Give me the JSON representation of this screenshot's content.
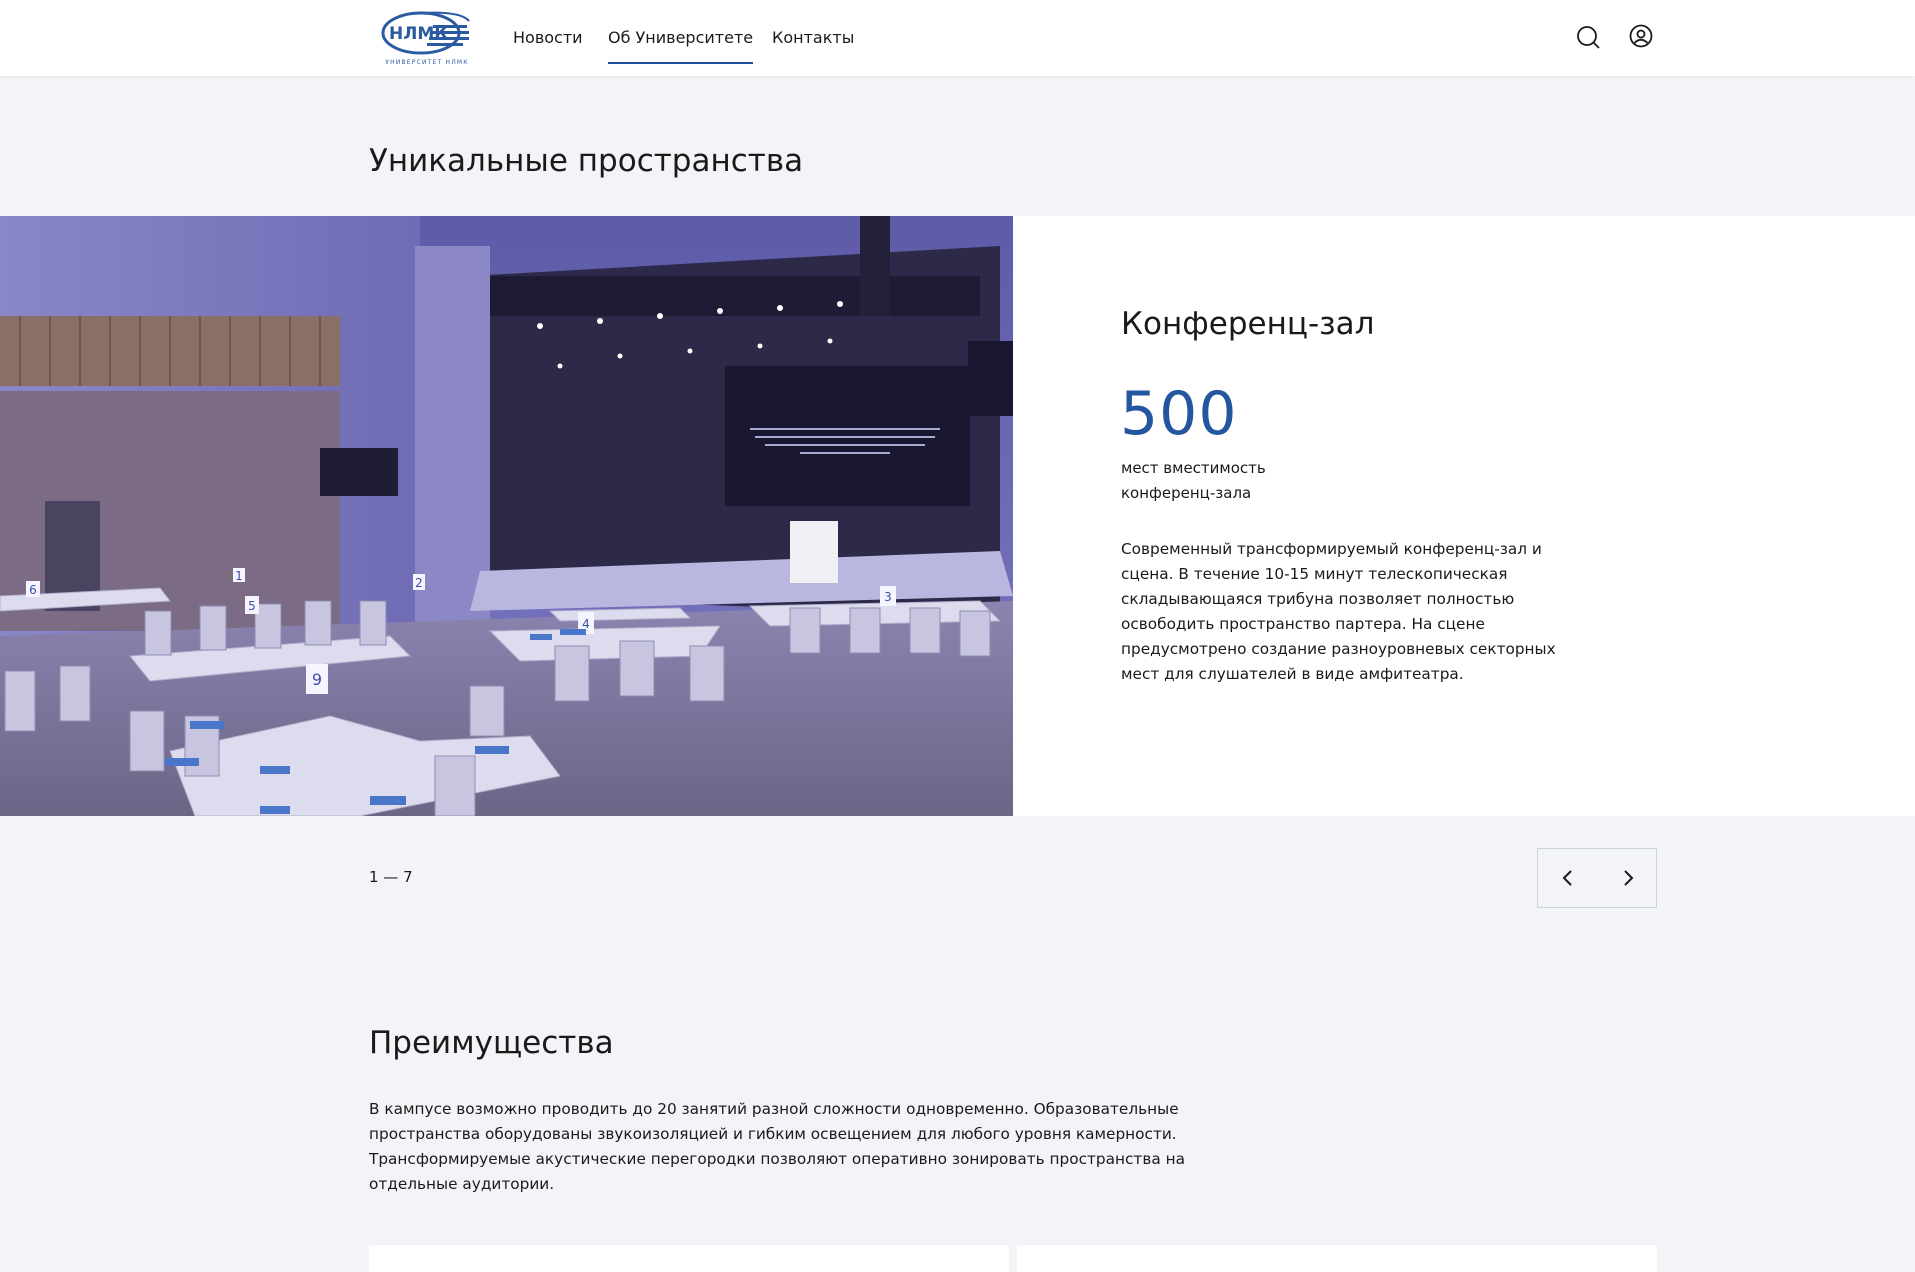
{
  "header": {
    "logo_text": "НЛМК",
    "logo_subtitle": "УНИВЕРСИТЕТ НЛМК",
    "nav": [
      {
        "label": "Новости",
        "active": false
      },
      {
        "label": "Об Университете",
        "active": true
      },
      {
        "label": "Контакты",
        "active": false
      }
    ],
    "icons": [
      "search-icon",
      "user-icon"
    ]
  },
  "spaces": {
    "title": "Уникальные пространства",
    "slide": {
      "title": "Конференц-зал",
      "number": "500",
      "caption_line1": "мест вместимость",
      "caption_line2": "конференц-зала",
      "description": "Современный трансформируемый конференц-зал и сцена. В течение 10-15 минут телескопическая складывающаяся трибуна позволяет полностью освободить пространство партера. На сцене предусмотрено создание разноуровневых секторных мест для слушателей в виде амфитеатра.",
      "image": {
        "alt": "Conference hall with tables, stage and large screen",
        "table_numbers": [
          "6",
          "5",
          "2",
          "1",
          "4",
          "3",
          "9"
        ]
      }
    },
    "pager": "1 — 7",
    "prev_icon": "chevron-left-icon",
    "next_icon": "chevron-right-icon"
  },
  "advantages": {
    "title": "Преимущества",
    "text": "В кампусе возможно проводить до 20 занятий разной сложности одновременно. Образовательные пространства оборудованы звукоизоляцией и гибким освещением для любого уровня камерности. Трансформируемые акустические перегородки позволяют оперативно зонировать пространства на отдельные аудитории."
  },
  "colors": {
    "accent": "#23569f",
    "background": "#f3f4f7",
    "panel": "#ffffff"
  }
}
